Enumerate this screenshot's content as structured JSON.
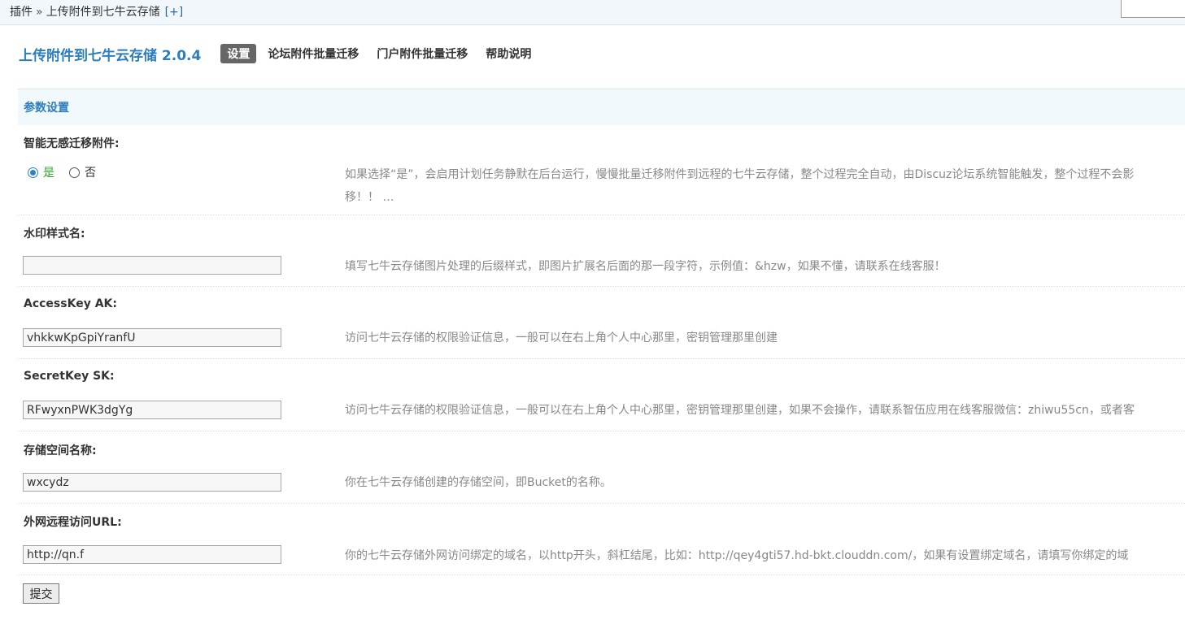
{
  "breadcrumb": {
    "root": "插件",
    "separator": "»",
    "current": "上传附件到七牛云存储",
    "expand": "[+]"
  },
  "header": {
    "title": "上传附件到七牛云存储 2.0.4",
    "tabs": [
      {
        "label": "设置",
        "active": true
      },
      {
        "label": "论坛附件批量迁移",
        "active": false
      },
      {
        "label": "门户附件批量迁移",
        "active": false
      },
      {
        "label": "帮助说明",
        "active": false
      }
    ]
  },
  "section": {
    "title": "参数设置"
  },
  "fields": {
    "smart_migrate": {
      "label": "智能无感迁移附件:",
      "options": [
        {
          "label": "是",
          "checked": true
        },
        {
          "label": "否",
          "checked": false
        }
      ],
      "description_line1": "如果选择“是”，会启用计划任务静默在后台运行，慢慢批量迁移附件到远程的七牛云存储，整个过程完全自动，由Discuz论坛系统智能触发，整个过程不会影",
      "description_line2": "移！！ …"
    },
    "watermark": {
      "label": "水印样式名:",
      "value": "",
      "description": "填写七牛云存储图片处理的后缀样式，即图片扩展名后面的那一段字符，示例值：&hzw，如果不懂，请联系在线客服！"
    },
    "access_key": {
      "label": "AccessKey AK:",
      "value": "vhkkwKpGpiYranfU",
      "description": "访问七牛云存储的权限验证信息，一般可以在右上角个人中心那里，密钥管理那里创建"
    },
    "secret_key": {
      "label": "SecretKey SK:",
      "value": "RFwyxnPWK3dgYg",
      "description": "访问七牛云存储的权限验证信息，一般可以在右上角个人中心那里，密钥管理那里创建，如果不会操作，请联系智伍应用在线客服微信：zhiwu55cn，或者客"
    },
    "bucket": {
      "label": "存储空间名称:",
      "value": "wxcydz",
      "description": "你在七牛云存储创建的存储空间，即Bucket的名称。"
    },
    "remote_url": {
      "label": "外网远程访问URL:",
      "value": "http://qn.f",
      "description": "你的七牛云存储外网访问绑定的域名，以http开头，斜杠结尾，比如：http://qey4gti57.hd-bkt.clouddn.com/，如果有设置绑定域名，请填写你绑定的域"
    }
  },
  "submit_label": "提交",
  "colors": {
    "accent": "#2b7dbc",
    "active_tab_bg": "#666666",
    "section_bg": "#f2f9fd",
    "yes_label": "#2aa52a",
    "description": "#888888"
  }
}
